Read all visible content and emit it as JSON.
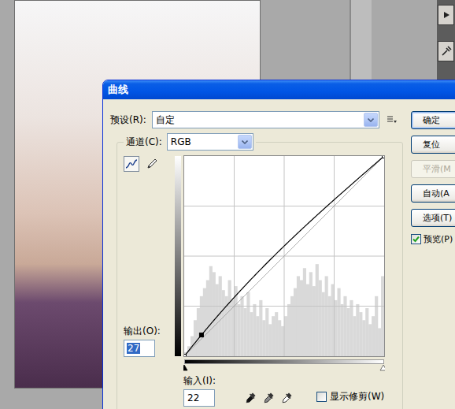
{
  "window": {
    "title": "曲线"
  },
  "preset": {
    "label": "预设(R):",
    "value": "自定"
  },
  "channel": {
    "label": "通道(C):",
    "value": "RGB"
  },
  "tools": [
    {
      "kind": "curve",
      "selected": true
    },
    {
      "kind": "pencil",
      "selected": false
    }
  ],
  "curve": {
    "points": [
      [
        0,
        0
      ],
      [
        22,
        27
      ],
      [
        255,
        255
      ]
    ],
    "selected_point": 1
  },
  "histogram": [
    2,
    5,
    10,
    18,
    24,
    30,
    34,
    38,
    45,
    42,
    36,
    40,
    33,
    30,
    38,
    28,
    35,
    26,
    30,
    24,
    32,
    22,
    26,
    20,
    28,
    18,
    24,
    16,
    20,
    22,
    18,
    15,
    20,
    26,
    30,
    34,
    40,
    38,
    44,
    36,
    42,
    35,
    46,
    38,
    32,
    40,
    30,
    36,
    28,
    34,
    26,
    30,
    24,
    28,
    20,
    26,
    22,
    18,
    24,
    16,
    20,
    30,
    14,
    40
  ],
  "input_sliders": {
    "black": 0,
    "white": 255
  },
  "output": {
    "label": "输出(O):",
    "value": "27",
    "selected": true
  },
  "input": {
    "label": "输入(I):",
    "value": "22"
  },
  "buttons": [
    {
      "label": "确定",
      "disabled": false,
      "default": true
    },
    {
      "label": "复位",
      "disabled": false,
      "default": false
    },
    {
      "label": "平滑(M",
      "disabled": true,
      "default": false
    },
    {
      "label": "自动(A",
      "disabled": false,
      "default": false
    },
    {
      "label": "选项(T)",
      "disabled": false,
      "default": false
    }
  ],
  "preview": {
    "label": "预览(P)",
    "checked": true
  },
  "show_clipping": {
    "label": "显示修剪(W)",
    "checked": false
  }
}
